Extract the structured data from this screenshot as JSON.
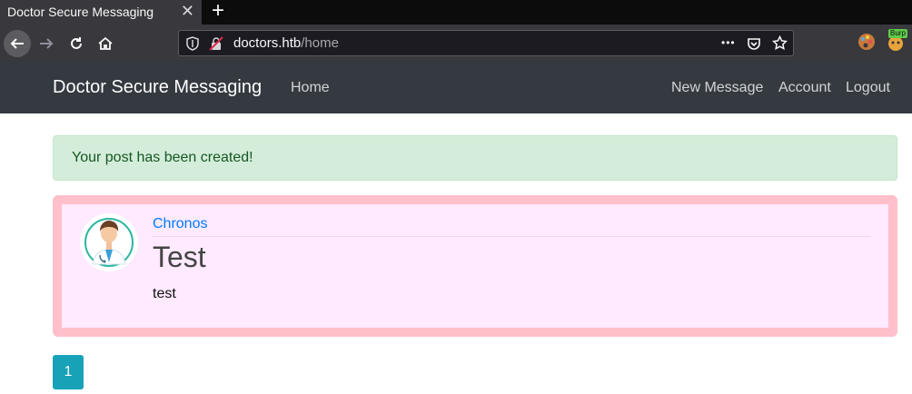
{
  "browser": {
    "tab_title": "Doctor Secure Messaging",
    "tab_close": "✕",
    "new_tab": "+",
    "url_host": "doctors.htb",
    "url_path": "/home",
    "more": "•••",
    "extension_badge": "Burp"
  },
  "site": {
    "brand": "Doctor Secure Messaging",
    "nav_home": "Home",
    "nav_new_message": "New Message",
    "nav_account": "Account",
    "nav_logout": "Logout"
  },
  "alert": {
    "message": "Your post has been created!"
  },
  "post": {
    "author": "Chronos",
    "title": "Test",
    "body": "test"
  },
  "pagination": {
    "current": "1"
  },
  "colors": {
    "navbar": "#343a40",
    "alert_bg": "#d4edda",
    "post_border": "#ffc0cb",
    "post_bg": "#ffeaff",
    "link": "#007bff",
    "page_button": "#17a2b8"
  }
}
